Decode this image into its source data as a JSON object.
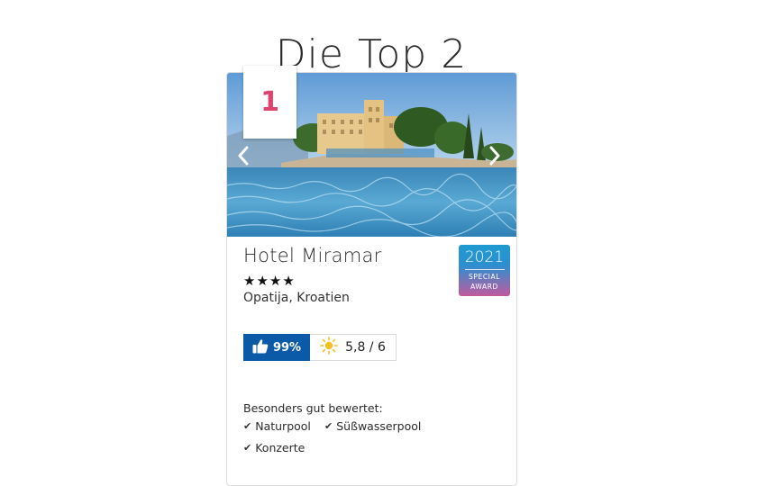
{
  "page": {
    "title": "Die Top 2"
  },
  "hotel": {
    "rank": "1",
    "name": "Hotel Miramar",
    "stars": "★★★★",
    "location": "Opatija, Kroatien"
  },
  "award": {
    "year": "2021",
    "line1": "SPECIAL",
    "line2": "AWARD"
  },
  "ratings": {
    "recommendation": "99%",
    "weather_score": "5,8 / 6"
  },
  "features": {
    "title": "Besonders gut bewertet:",
    "items": [
      "Naturpool",
      "Süßwasserpool",
      "Konzerte"
    ]
  },
  "colors": {
    "rank": "#e0446e",
    "recommend_bg": "#0a5aa8",
    "award_top": "#1f9ad0",
    "award_bottom": "#c05a9e",
    "sun": "#f4c020"
  },
  "icons": {
    "prev": "chevron-left-icon",
    "next": "chevron-right-icon",
    "thumb": "thumbs-up-icon",
    "sun": "sun-icon",
    "check": "check-icon"
  }
}
